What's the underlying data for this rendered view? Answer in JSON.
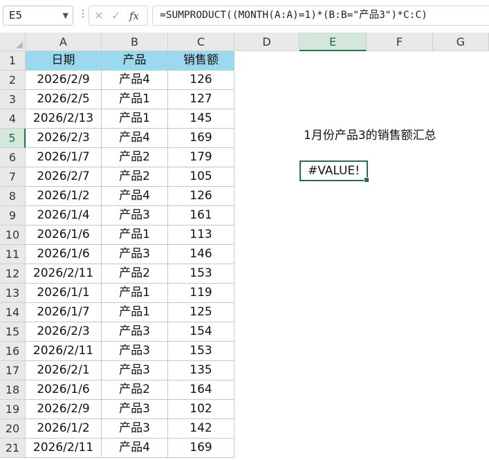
{
  "name_box": "E5",
  "formula": "=SUMPRODUCT((MONTH(A:A)=1)*(B:B=\"产品3\")*C:C)",
  "icons": {
    "chevron": "chevron-down-icon",
    "cancel": "cancel-x-icon",
    "enter": "check-icon",
    "function": "fx-icon"
  },
  "columns": [
    "A",
    "B",
    "C",
    "D",
    "E",
    "F",
    "G"
  ],
  "rows": [
    "1",
    "2",
    "3",
    "4",
    "5",
    "6",
    "7",
    "8",
    "9",
    "10",
    "11",
    "12",
    "13",
    "14",
    "15",
    "16",
    "17",
    "18",
    "19",
    "20",
    "21"
  ],
  "active_column": "E",
  "active_row": "5",
  "headers": [
    "日期",
    "产品",
    "销售额"
  ],
  "table": [
    [
      "2026/2/9",
      "产品4",
      "126"
    ],
    [
      "2026/2/5",
      "产品1",
      "127"
    ],
    [
      "2026/2/13",
      "产品1",
      "145"
    ],
    [
      "2026/2/3",
      "产品4",
      "169"
    ],
    [
      "2026/1/7",
      "产品2",
      "179"
    ],
    [
      "2026/2/7",
      "产品2",
      "105"
    ],
    [
      "2026/1/2",
      "产品4",
      "126"
    ],
    [
      "2026/1/4",
      "产品3",
      "161"
    ],
    [
      "2026/1/6",
      "产品1",
      "113"
    ],
    [
      "2026/1/6",
      "产品3",
      "146"
    ],
    [
      "2026/2/11",
      "产品2",
      "153"
    ],
    [
      "2026/1/1",
      "产品1",
      "119"
    ],
    [
      "2026/1/7",
      "产品1",
      "125"
    ],
    [
      "2026/2/3",
      "产品3",
      "154"
    ],
    [
      "2026/2/11",
      "产品3",
      "153"
    ],
    [
      "2026/2/1",
      "产品3",
      "135"
    ],
    [
      "2026/1/6",
      "产品2",
      "164"
    ],
    [
      "2026/2/9",
      "产品3",
      "102"
    ],
    [
      "2026/1/2",
      "产品3",
      "142"
    ],
    [
      "2026/2/11",
      "产品4",
      "169"
    ]
  ],
  "e3_text": "1月份产品3的销售额汇总",
  "e5_value": "#VALUE!",
  "colors": {
    "header_fill": "#9ad9f0",
    "selection": "#217346"
  }
}
